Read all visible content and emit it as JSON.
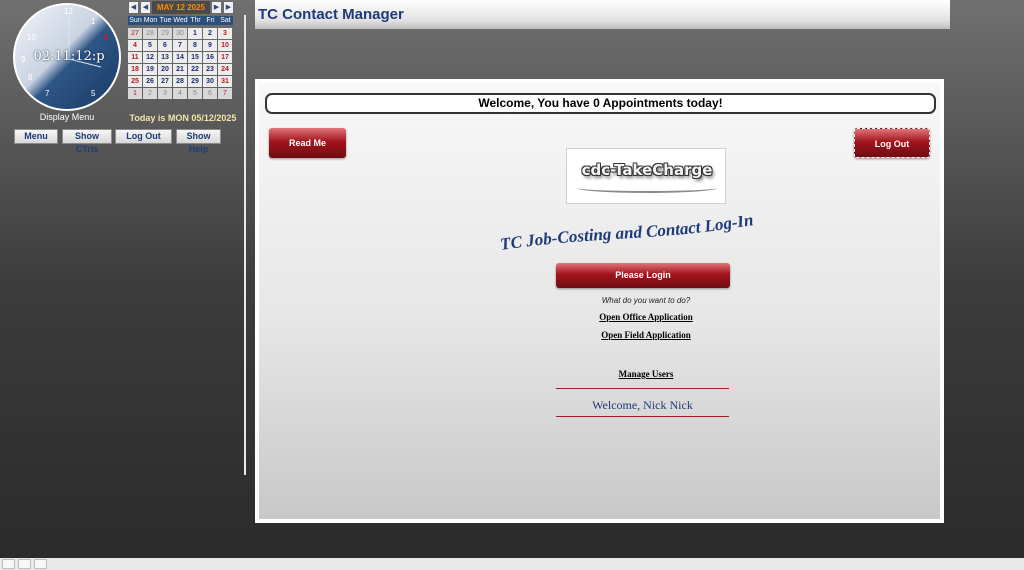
{
  "clock": {
    "time": "02:11:12:p",
    "numbers": [
      "12",
      "1",
      "2",
      "10",
      "9",
      "8",
      "7",
      "5"
    ],
    "display_menu_label": "Display Menu"
  },
  "calendar": {
    "prev_year_icon": "double-left-arrow",
    "prev_month_icon": "left-arrow",
    "month_label": "MAY 12 2025",
    "next_month_icon": "right-arrow",
    "next_year_icon": "double-right-arrow",
    "weekdays": [
      "Sun",
      "Mon",
      "Tue",
      "Wed",
      "Thr",
      "Fri",
      "Sat"
    ],
    "days": [
      [
        "27",
        "28",
        "29",
        "30",
        "1",
        "2",
        "3"
      ],
      [
        "4",
        "5",
        "6",
        "7",
        "8",
        "9",
        "10"
      ],
      [
        "11",
        "12",
        "13",
        "14",
        "15",
        "16",
        "17"
      ],
      [
        "18",
        "19",
        "20",
        "21",
        "22",
        "23",
        "24"
      ],
      [
        "25",
        "26",
        "27",
        "28",
        "29",
        "30",
        "31"
      ],
      [
        "1",
        "2",
        "3",
        "4",
        "5",
        "6",
        "7"
      ]
    ],
    "today_text": "Today is MON 05/12/2025",
    "colors": {
      "weekend": "#c0161d",
      "weekday": "#1b2f6e",
      "other_month": "#8a8a8a",
      "month_label": "#ff8c00"
    }
  },
  "left_buttons": {
    "menu": "Menu",
    "show_ctrls": "Show CTrls",
    "log_out": "Log Out",
    "show_help": "Show Help"
  },
  "header": {
    "title": "TC Contact Manager"
  },
  "main": {
    "welcome_banner": "Welcome, You have 0 Appointments today!",
    "read_me": "Read Me",
    "log_out": "Log Out",
    "logo_text": "cdc-TakeCharge",
    "title": "TC Job-Costing and Contact Log-In",
    "login_button": "Please Login",
    "question": "What do you want to do?",
    "open_office": "Open Office Application",
    "open_field": "Open Field Application",
    "manage_users": "Manage Users",
    "welcome_user": "Welcome, Nick Nick"
  },
  "colors": {
    "accent_red": "#a3141c",
    "brand_blue": "#1f3a78"
  }
}
